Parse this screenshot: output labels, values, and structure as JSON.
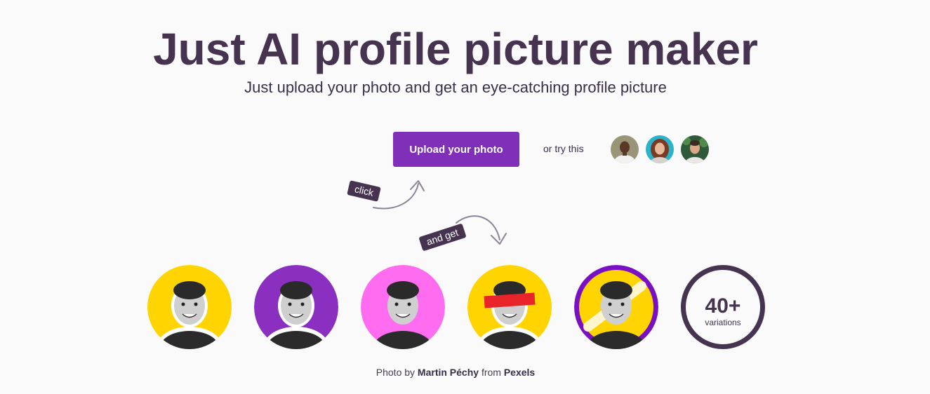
{
  "hero": {
    "title": "Just AI profile picture maker",
    "subtitle": "Just upload your photo and get an eye-catching profile picture"
  },
  "upload": {
    "button_label": "Upload your photo",
    "or_try_label": "or try this"
  },
  "samples": [
    {
      "name": "sample-avatar-1",
      "bg": "#9a9578"
    },
    {
      "name": "sample-avatar-2",
      "bg": "#2bb3c9"
    },
    {
      "name": "sample-avatar-3",
      "bg": "#2f5a3a"
    }
  ],
  "annotations": {
    "click_label": "click",
    "and_get_label": "and get"
  },
  "results": [
    {
      "style": "yellow",
      "bg": "#ffd400"
    },
    {
      "style": "purple",
      "bg": "#8a2fc0"
    },
    {
      "style": "pink",
      "bg": "#ff6cf0"
    },
    {
      "style": "yellow-red-bar",
      "bg": "#ffd400",
      "accent": "#e8242a"
    },
    {
      "style": "purple-ring-yellow",
      "bg": "#ffd400",
      "ring": "#7a10c4"
    }
  ],
  "variations": {
    "count": "40+",
    "label": "variations"
  },
  "credit": {
    "prefix": "Photo by",
    "author": "Martin Péchy",
    "middle": "from",
    "source": "Pexels"
  },
  "colors": {
    "brand": "#7f2fb8",
    "ink": "#45334f",
    "background": "#fafafa"
  }
}
